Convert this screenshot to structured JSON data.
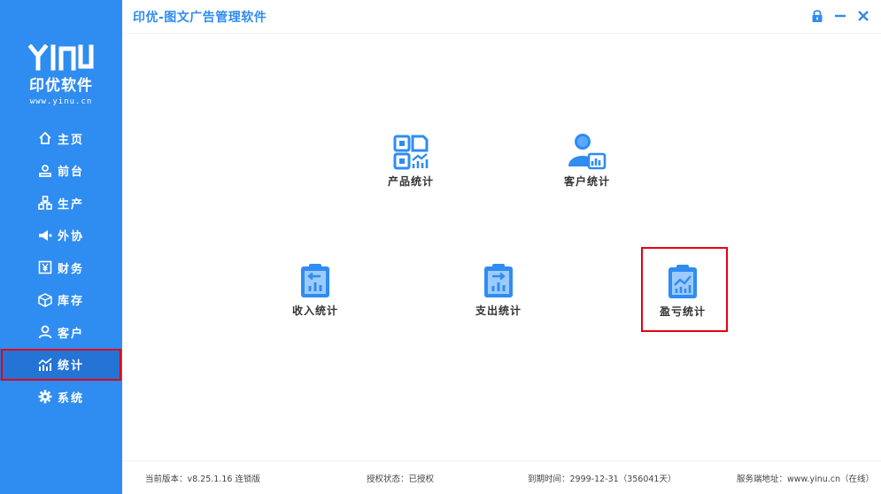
{
  "app": {
    "title": "印优-图文广告管理软件"
  },
  "logo": {
    "mark": "YINU",
    "name": "印优软件",
    "url": "www.yinu.cn"
  },
  "sidebar": {
    "items": [
      {
        "label": "主页",
        "icon": "home-icon"
      },
      {
        "label": "前台",
        "icon": "front-desk-icon"
      },
      {
        "label": "生产",
        "icon": "production-icon"
      },
      {
        "label": "外协",
        "icon": "outsource-icon"
      },
      {
        "label": "财务",
        "icon": "finance-icon"
      },
      {
        "label": "库存",
        "icon": "inventory-icon"
      },
      {
        "label": "客户",
        "icon": "customer-icon"
      },
      {
        "label": "统计",
        "icon": "statistics-icon",
        "active": true
      },
      {
        "label": "系统",
        "icon": "settings-icon"
      }
    ]
  },
  "tiles": {
    "product_stats": "产品统计",
    "customer_stats": "客户统计",
    "income_stats": "收入统计",
    "expense_stats": "支出统计",
    "profit_loss_stats": "盈亏统计"
  },
  "footer": {
    "version": "当前版本：v8.25.1.16  连锁版",
    "license": "授权状态：已授权",
    "expiry": "到期时间：2999-12-31（356041天）",
    "server": "服务端地址：www.yinu.cn（在线）"
  },
  "colors": {
    "brand": "#2f8cf0",
    "active_nav": "#2474d6",
    "highlight": "#e60012"
  }
}
